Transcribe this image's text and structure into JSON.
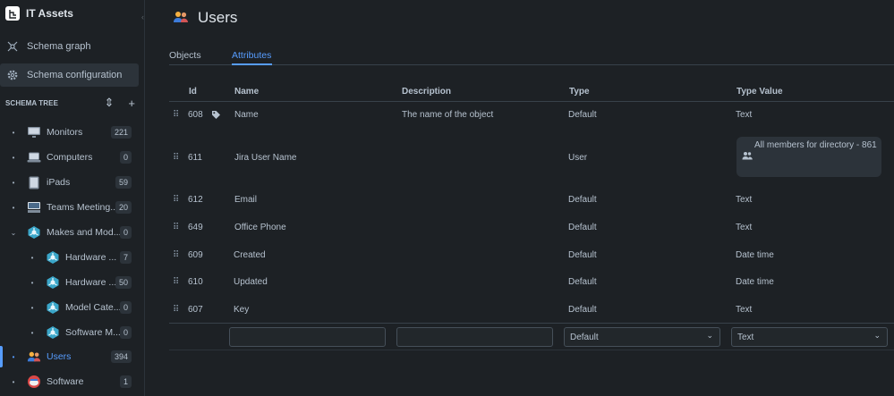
{
  "app": {
    "title": "IT Assets"
  },
  "nav": {
    "schema_graph": "Schema graph",
    "schema_configuration": "Schema configuration"
  },
  "schema_tree": {
    "header": "SCHEMA TREE",
    "items": [
      {
        "label": "Monitors",
        "count": "221",
        "icon": "monitor-icon"
      },
      {
        "label": "Computers",
        "count": "0",
        "icon": "laptop-icon"
      },
      {
        "label": "iPads",
        "count": "59",
        "icon": "tablet-icon"
      },
      {
        "label": "Teams Meeting...",
        "count": "20",
        "icon": "meeting-device-icon"
      },
      {
        "label": "Makes and Mod...",
        "count": "0",
        "icon": "network-icon"
      },
      {
        "label": "Hardware ...",
        "count": "7",
        "icon": "network-icon"
      },
      {
        "label": "Hardware ...",
        "count": "50",
        "icon": "network-icon"
      },
      {
        "label": "Model Cate...",
        "count": "0",
        "icon": "network-icon"
      },
      {
        "label": "Software M...",
        "count": "0",
        "icon": "network-icon"
      },
      {
        "label": "Users",
        "count": "394",
        "icon": "users-icon"
      },
      {
        "label": "Software",
        "count": "1",
        "icon": "software-icon"
      }
    ]
  },
  "page": {
    "title": "Users"
  },
  "tabs": [
    "Objects",
    "Attributes"
  ],
  "table": {
    "headers": [
      "Id",
      "Name",
      "Description",
      "Type",
      "Type Value"
    ],
    "rows": [
      {
        "id": "608",
        "name": "Name",
        "description": "The name of the object",
        "type": "Default",
        "type_value": "Text"
      },
      {
        "id": "611",
        "name": "Jira User Name",
        "description": "",
        "type": "User",
        "type_value": "All members for directory - 861"
      },
      {
        "id": "612",
        "name": "Email",
        "description": "",
        "type": "Default",
        "type_value": "Text"
      },
      {
        "id": "649",
        "name": "Office Phone",
        "description": "",
        "type": "Default",
        "type_value": "Text"
      },
      {
        "id": "609",
        "name": "Created",
        "description": "",
        "type": "Default",
        "type_value": "Date time"
      },
      {
        "id": "610",
        "name": "Updated",
        "description": "",
        "type": "Default",
        "type_value": "Date time"
      },
      {
        "id": "607",
        "name": "Key",
        "description": "",
        "type": "Default",
        "type_value": "Text"
      }
    ],
    "new_row": {
      "type": "Default",
      "type_value": "Text"
    }
  },
  "colors": {
    "accent": "#579dff",
    "background": "#1d2125",
    "surface": "#2c333a"
  }
}
